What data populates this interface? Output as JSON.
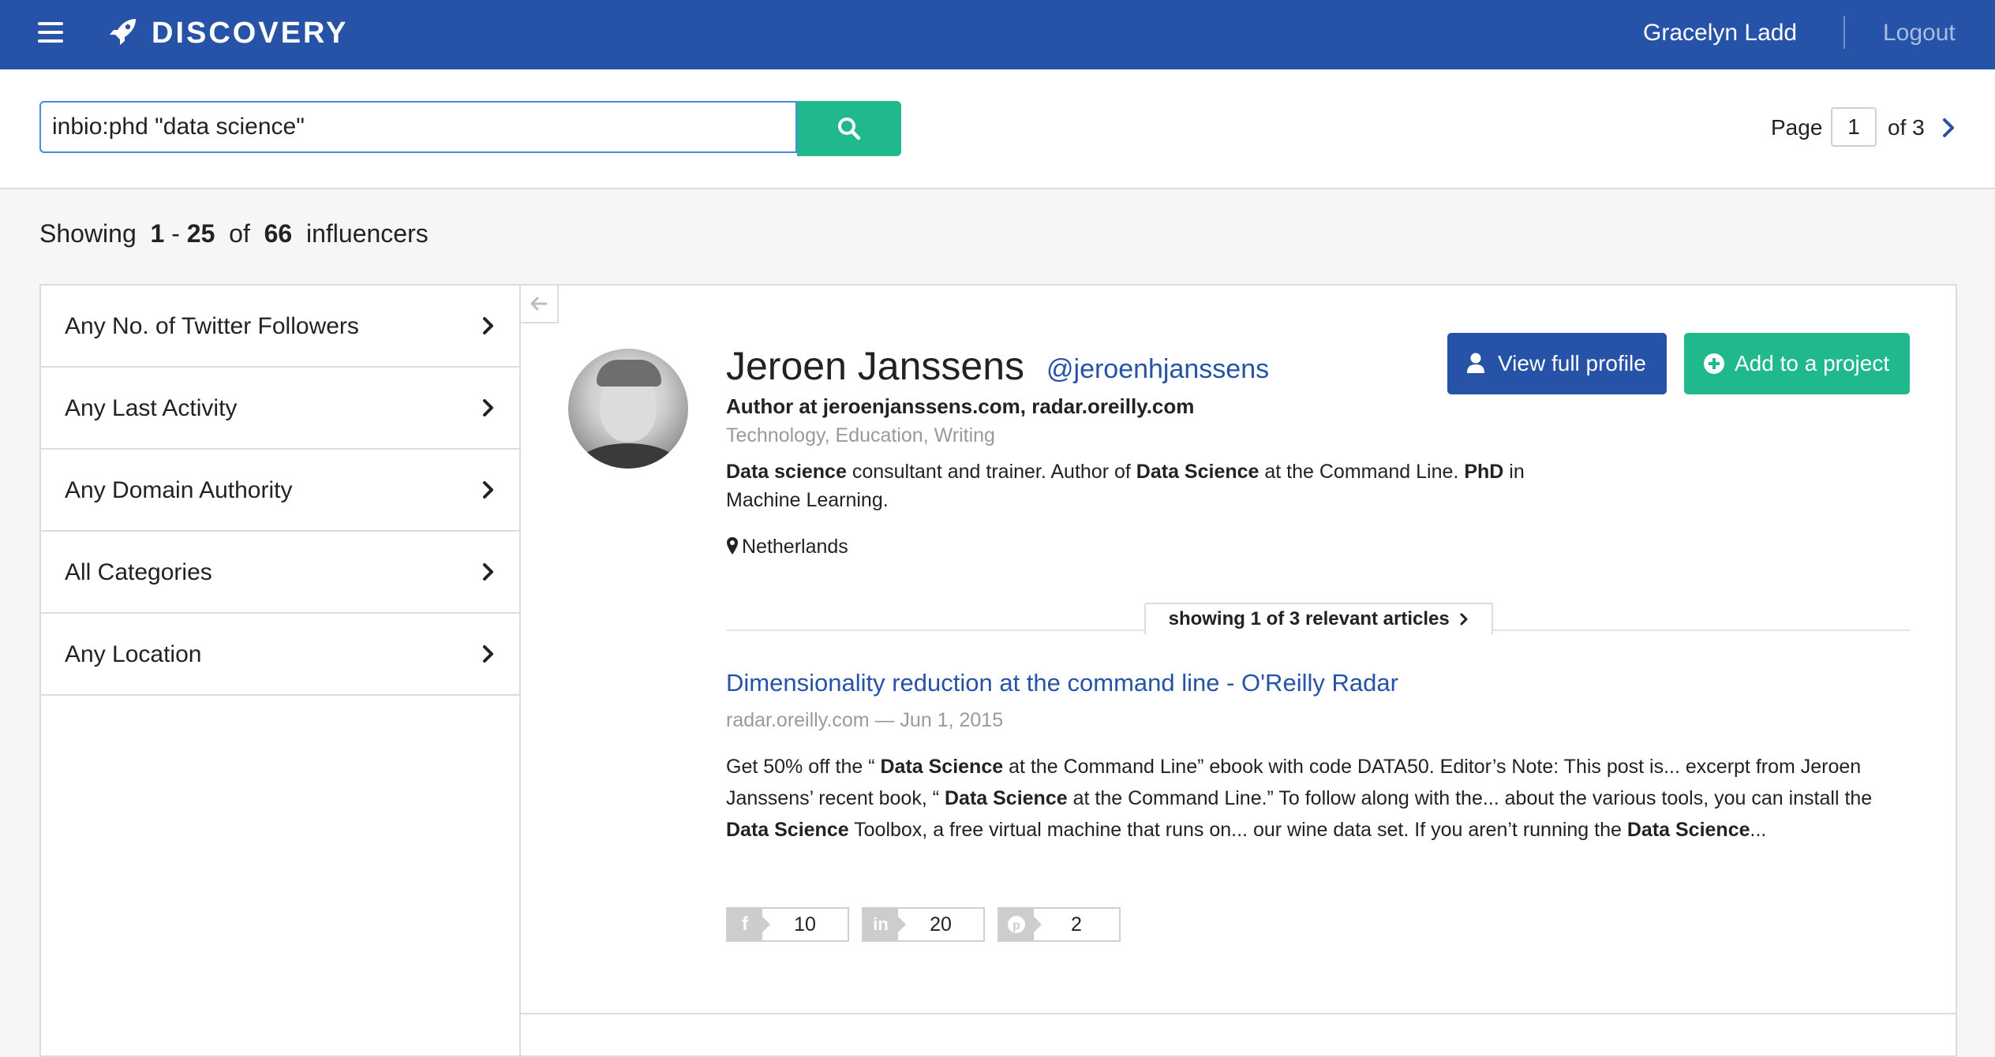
{
  "header": {
    "brand": "DISCOVERY",
    "user_name": "Gracelyn Ladd",
    "logout_label": "Logout",
    "bar_color": "#2653a8"
  },
  "search": {
    "value": "inbio:phd \"data science\"",
    "button_icon": "search-icon",
    "button_color": "#20b98e"
  },
  "pagination": {
    "page_label": "Page",
    "current_page": "1",
    "of_label": "of 3"
  },
  "results": {
    "showing_prefix": "Showing",
    "range_start": "1",
    "range_sep": "-",
    "range_end": "25",
    "of_label": "of",
    "total": "66",
    "noun": "influencers"
  },
  "filters": [
    {
      "label": "Any No. of Twitter Followers"
    },
    {
      "label": "Any Last Activity"
    },
    {
      "label": "Any Domain Authority"
    },
    {
      "label": "All Categories"
    },
    {
      "label": "Any Location"
    }
  ],
  "profile": {
    "name": "Jeroen Janssens",
    "handle": "@jeroenhjanssens",
    "role": "Author at jeroenjanssens.com, radar.oreilly.com",
    "categories": "Technology, Education, Writing",
    "bio": {
      "b1": "Data science",
      "t1": " consultant and trainer. Author of ",
      "b2": "Data Science",
      "t2": " at the Command Line. ",
      "b3": "PhD",
      "t3": " in Machine Learning."
    },
    "location": "Netherlands",
    "view_profile_label": "View full profile",
    "add_project_label": "Add to a project"
  },
  "articles": {
    "tab_label": "showing 1 of 3 relevant articles",
    "title": "Dimensionality reduction at the command line - O'Reilly Radar",
    "meta": "radar.oreilly.com — Jun 1, 2015",
    "body": {
      "t1": "Get 50% off the “ ",
      "b1": "Data Science",
      "t2": " at the Command Line” ebook with code DATA50. Editor’s Note: This post is... excerpt from Jeroen Janssens’ recent book, “ ",
      "b2": "Data Science",
      "t3": " at the Command Line.” To follow along with the... about the various tools, you can install the ",
      "b3": "Data Science",
      "t4": " Toolbox, a free virtual machine that runs on... our wine data set. If you aren’t running the ",
      "b4": "Data Science",
      "t5": "..."
    },
    "shares": [
      {
        "network": "facebook",
        "icon": "facebook-icon",
        "glyph": "f",
        "count": "10"
      },
      {
        "network": "linkedin",
        "icon": "linkedin-icon",
        "glyph": "in",
        "count": "20"
      },
      {
        "network": "pinterest",
        "icon": "pinterest-icon",
        "glyph": "p",
        "count": "2"
      }
    ]
  }
}
